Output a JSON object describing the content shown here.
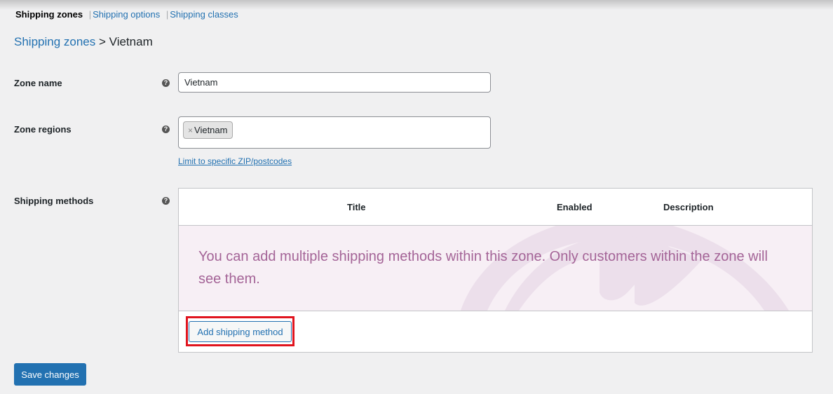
{
  "subnav": {
    "current": "Shipping zones",
    "links": [
      "Shipping options",
      "Shipping classes"
    ],
    "separator": "|"
  },
  "breadcrumb": {
    "parent": "Shipping zones",
    "separator": ">",
    "current": "Vietnam"
  },
  "form": {
    "zone_name": {
      "label": "Zone name",
      "value": "Vietnam",
      "help_icon": "question-circle-icon"
    },
    "zone_regions": {
      "label": "Zone regions",
      "selected": [
        {
          "remove_glyph": "×",
          "name": "Vietnam"
        }
      ],
      "help_icon": "question-circle-icon",
      "limit_link": "Limit to specific ZIP/postcodes"
    },
    "shipping_methods": {
      "label": "Shipping methods",
      "help_icon": "question-circle-icon",
      "columns": [
        "Title",
        "Enabled",
        "Description"
      ],
      "empty_message": "You can add multiple shipping methods within this zone. Only customers within the zone will see them.",
      "add_button": "Add shipping method"
    }
  },
  "save_button": "Save changes",
  "colors": {
    "accent": "#2271b1",
    "empty_bg": "#f7eff5",
    "empty_text": "#a46497",
    "highlight": "#e0141e"
  }
}
